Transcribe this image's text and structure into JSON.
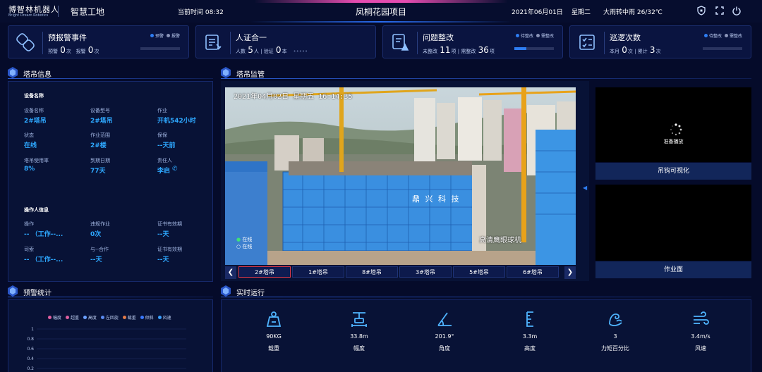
{
  "header": {
    "logo_main": "博智林机器人",
    "logo_sub": "Bright Dream Robotics",
    "site_name": "智慧工地",
    "time_label": "当前时间 08:32",
    "project": "凤桐花园项目",
    "date": "2021年06月01日",
    "weekday": "星期二",
    "weather": "大雨转中雨 26/32℃"
  },
  "cards": [
    {
      "title": "预报警事件",
      "icon": "alert-link-icon",
      "s1_label": "预警",
      "s1_value": "0",
      "s1_unit": "次",
      "s2_label": "报警",
      "s2_value": "0",
      "s2_unit": "次",
      "legend1": "预警",
      "legend2": "报警",
      "progress": 0
    },
    {
      "title": "人证合一",
      "icon": "id-card-icon",
      "s1_label": "人数",
      "s1_value": "5",
      "s1_unit": "人",
      "s2_label": "验证",
      "s2_value": "0",
      "s2_unit": "本",
      "extra": "•••••"
    },
    {
      "title": "问题整改",
      "icon": "rectify-icon",
      "s1_label": "未整改",
      "s1_value": "11",
      "s1_unit": "项",
      "s2_label": "需整改",
      "s2_value": "36",
      "s2_unit": "项",
      "legend1": "待整改",
      "legend2": "需整改",
      "progress": 0.3
    },
    {
      "title": "巡逻次数",
      "icon": "patrol-checklist-icon",
      "s1_label": "本月",
      "s1_value": "0",
      "s1_unit": "次",
      "s2_label": "累计",
      "s2_value": "3",
      "s2_unit": "次",
      "legend1": "待整改",
      "legend2": "需整改",
      "progress": 0
    }
  ],
  "tower_info": {
    "section_title": "塔吊信息",
    "device_header": "设备名称",
    "fields": [
      {
        "label": "设备名称",
        "value": "2#塔吊"
      },
      {
        "label": "设备型号",
        "value": "2#塔吊"
      },
      {
        "label": "作业",
        "value": "开机542小时"
      },
      {
        "label": "状态",
        "value": "在线"
      },
      {
        "label": "作业范围",
        "value": "2#楼"
      },
      {
        "label": "保保",
        "value": "--天前"
      },
      {
        "label": "塔吊使用率",
        "value": "8%"
      },
      {
        "label": "到期日期",
        "value": "77天"
      },
      {
        "label": "责任人",
        "value": "李启"
      }
    ],
    "operator_header": "操作人信息",
    "operator_fields": [
      {
        "label": "操作",
        "value": "-- （工作--..."
      },
      {
        "label": "违规作业",
        "value": "0次"
      },
      {
        "label": "证书有效期",
        "value": "--天"
      },
      {
        "label": "司索",
        "value": "-- （工作--..."
      },
      {
        "label": "与--合作",
        "value": "--天"
      },
      {
        "label": "证书有效期",
        "value": "--天"
      }
    ]
  },
  "monitor": {
    "section_title": "塔吊监管",
    "osd_time": "2021年04月02日 星期五 16:14:35",
    "osd_brand": "高清鹰眼球机",
    "building_label": "鼎 兴 科 技",
    "osd_status1": "在线",
    "osd_status2": "在线",
    "tabs": [
      "2#塔吊",
      "1#塔吊",
      "8#塔吊",
      "3#塔吊",
      "5#塔吊",
      "6#塔吊"
    ],
    "active_tab": 0,
    "prev": "❮",
    "next": "❯",
    "player_status": "准备播放",
    "side_btn_1": "吊钩可视化",
    "side_btn_2": "作业面",
    "collapse": "◀"
  },
  "alerts": {
    "section_title": "预警统计",
    "legend": [
      {
        "name": "幅度",
        "color": "#e05fa0"
      },
      {
        "name": "超重",
        "color": "#e05fa0"
      },
      {
        "name": "高度",
        "color": "#6aa0ff"
      },
      {
        "name": "左回旋",
        "color": "#5a8af0"
      },
      {
        "name": "载重",
        "color": "#e27a48"
      },
      {
        "name": "倾斜",
        "color": "#3a78ff"
      },
      {
        "name": "风速",
        "color": "#3aa0ff"
      }
    ],
    "chart_data": {
      "type": "line",
      "title": "",
      "xlabel": "",
      "ylabel": "",
      "ylim": [
        0,
        1
      ],
      "y_ticks": [
        "1",
        "0.8",
        "0.6",
        "0.4",
        "0.2"
      ],
      "series": []
    }
  },
  "realtime": {
    "section_title": "实时运行",
    "metrics": [
      {
        "value": "90KG",
        "label": "载重",
        "icon": "weight-icon"
      },
      {
        "value": "33.8m",
        "label": "幅度",
        "icon": "range-icon"
      },
      {
        "value": "201.9°",
        "label": "角度",
        "icon": "angle-icon"
      },
      {
        "value": "3.3m",
        "label": "高度",
        "icon": "height-icon"
      },
      {
        "value": "3",
        "label": "力矩百分比",
        "icon": "torque-icon"
      },
      {
        "value": "3.4m/s",
        "label": "风速",
        "icon": "wind-icon"
      }
    ]
  }
}
